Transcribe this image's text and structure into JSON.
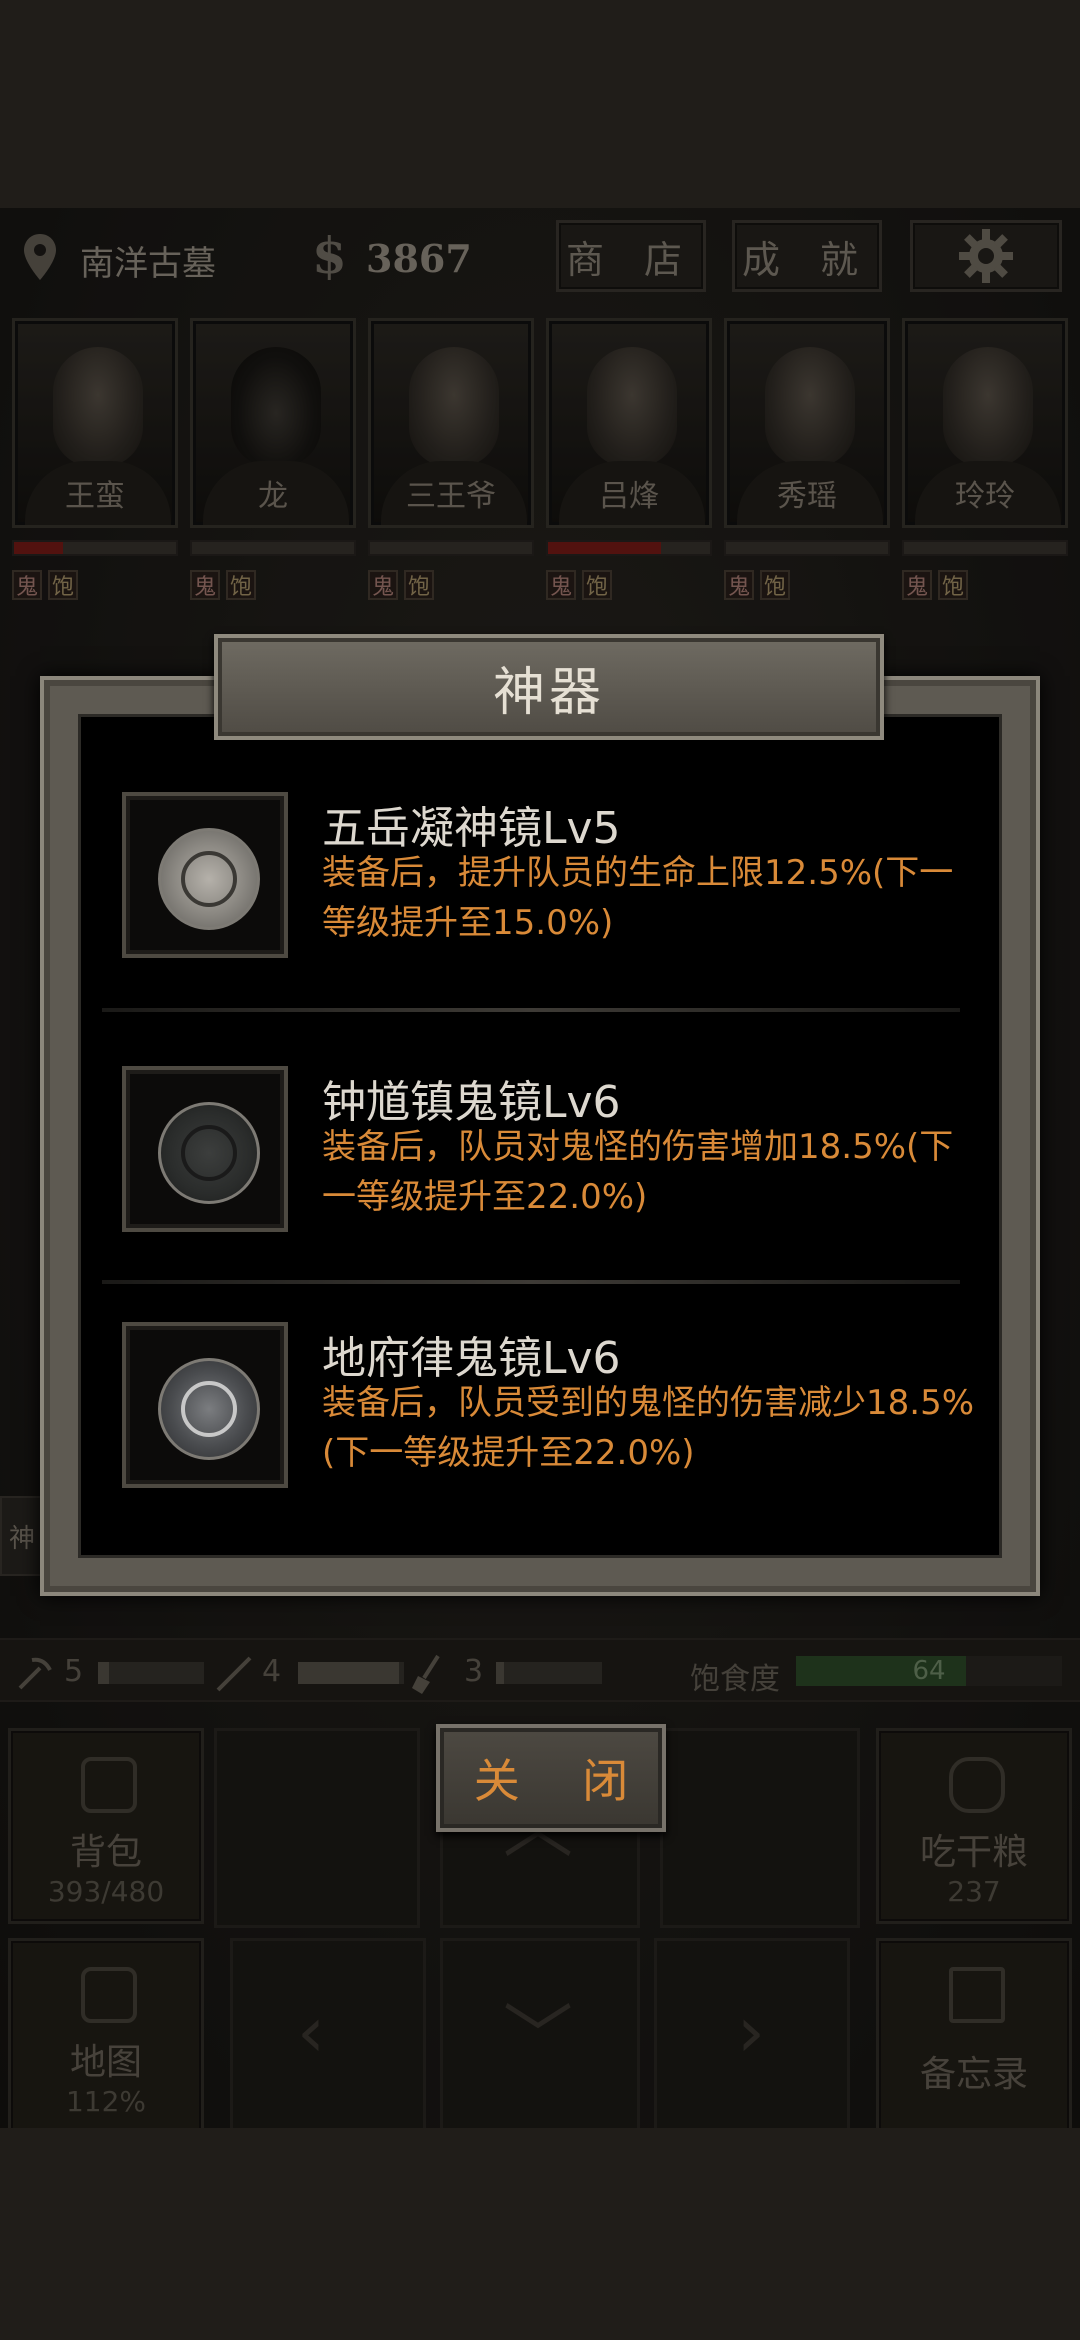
{
  "header": {
    "location": "南洋古墓",
    "currency_symbol": "$",
    "money": "3867",
    "shop_label": "商 店",
    "achievement_label": "成 就"
  },
  "team": [
    {
      "name": "王蛮",
      "hp": 0.3,
      "tag_ghost": "鬼",
      "tag_full": "饱"
    },
    {
      "name": "龙",
      "hp": 0.0,
      "tag_ghost": "鬼",
      "tag_full": "饱"
    },
    {
      "name": "三王爷",
      "hp": 0.0,
      "tag_ghost": "鬼",
      "tag_full": "饱"
    },
    {
      "name": "吕烽",
      "hp": 0.7,
      "tag_ghost": "鬼",
      "tag_full": "饱"
    },
    {
      "name": "秀瑶",
      "hp": 0.0,
      "tag_ghost": "鬼",
      "tag_full": "饱"
    },
    {
      "name": "玲玲",
      "hp": 0.0,
      "tag_ghost": "鬼",
      "tag_full": "饱"
    }
  ],
  "side_chip": "神",
  "resources": {
    "tool1": "5",
    "tool1_fill": 0.1,
    "tool2": "4",
    "tool2_fill": 0.95,
    "tool3": "3",
    "tool3_fill": 0.08,
    "satiety_label": "饱食度",
    "satiety_value": "64",
    "satiety_fill": 0.64
  },
  "bottom": {
    "bag_label": "背包",
    "bag_count": "393/480",
    "eat_label": "吃干粮",
    "eat_count": "237",
    "map_label": "地图",
    "map_percent": "112%",
    "memo_label": "备忘录"
  },
  "modal": {
    "title": "神器",
    "items": [
      {
        "name": "五岳凝神镜Lv5",
        "desc": "装备后，提升队员的生命上限12.5%(下一等级提升至15.0%)"
      },
      {
        "name": "钟馗镇鬼镜Lv6",
        "desc": "装备后，队员对鬼怪的伤害增加18.5%(下一等级提升至22.0%)"
      },
      {
        "name": "地府律鬼镜Lv6",
        "desc": "装备后，队员受到的鬼怪的伤害减少18.5%(下一等级提升至22.0%)"
      }
    ],
    "close_label": "关 闭"
  }
}
